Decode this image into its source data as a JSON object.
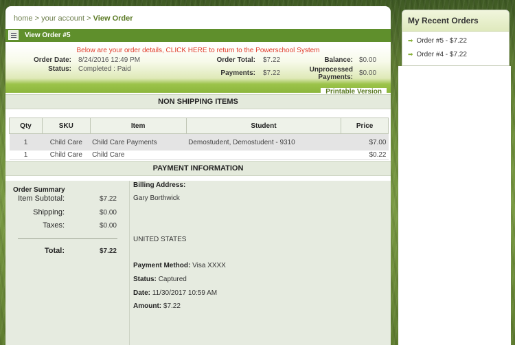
{
  "breadcrumb": {
    "home": "home",
    "sep1": ">",
    "account": "your account",
    "sep2": ">",
    "current": "View Order"
  },
  "title_bar": {
    "title": "View Order #5"
  },
  "order": {
    "notice": "Below are your order details, CLICK HERE to return to the Powerschool System",
    "order_date_label": "Order Date:",
    "order_date": "8/24/2016 12:49 PM",
    "status_label": "Status:",
    "status": "Completed : Paid",
    "order_total_label": "Order Total:",
    "order_total": "$7.22",
    "payments_label": "Payments:",
    "payments": "$7.22",
    "balance_label": "Balance:",
    "balance": "$0.00",
    "unprocessed_label": "Unprocessed Payments:",
    "unprocessed": "$0.00",
    "printable_label": "Printable Version"
  },
  "non_shipping": {
    "heading": "NON SHIPPING ITEMS",
    "columns": [
      "Qty",
      "SKU",
      "Item",
      "Student",
      "Price"
    ],
    "rows": [
      [
        "1",
        "Child Care",
        "Child Care Payments",
        "Demostudent, Demostudent - 9310",
        "$7.00"
      ],
      [
        "1",
        "Child Care",
        "Child Care",
        "",
        "$0.22"
      ]
    ]
  },
  "payment": {
    "heading": "PAYMENT INFORMATION",
    "summary_title": "Order Summary",
    "item_subtotal_label": "Item Subtotal:",
    "item_subtotal": "$7.22",
    "shipping_label": "Shipping:",
    "shipping": "$0.00",
    "taxes_label": "Taxes:",
    "taxes": "$0.00",
    "total_label": "Total:",
    "total": "$7.22",
    "billing_label": "Billing Address:",
    "billing_name": "Gary Borthwick",
    "billing_country": "UNITED STATES",
    "method_label": "Payment Method:",
    "method": "Visa XXXX",
    "status_label": "Status:",
    "status": "Captured",
    "date_label": "Date:",
    "date": "11/30/2017 10:59 AM",
    "amount_label": "Amount:",
    "amount": "$7.22"
  },
  "sidebar": {
    "title": "My Recent Orders",
    "items": [
      {
        "label": "Order #5 - $7.22"
      },
      {
        "label": "Order #4 - $7.22"
      }
    ]
  },
  "colors": {
    "accent_green": "#5f8f2c",
    "notice_red": "#e03a2a",
    "link_green": "#5b7a24"
  }
}
